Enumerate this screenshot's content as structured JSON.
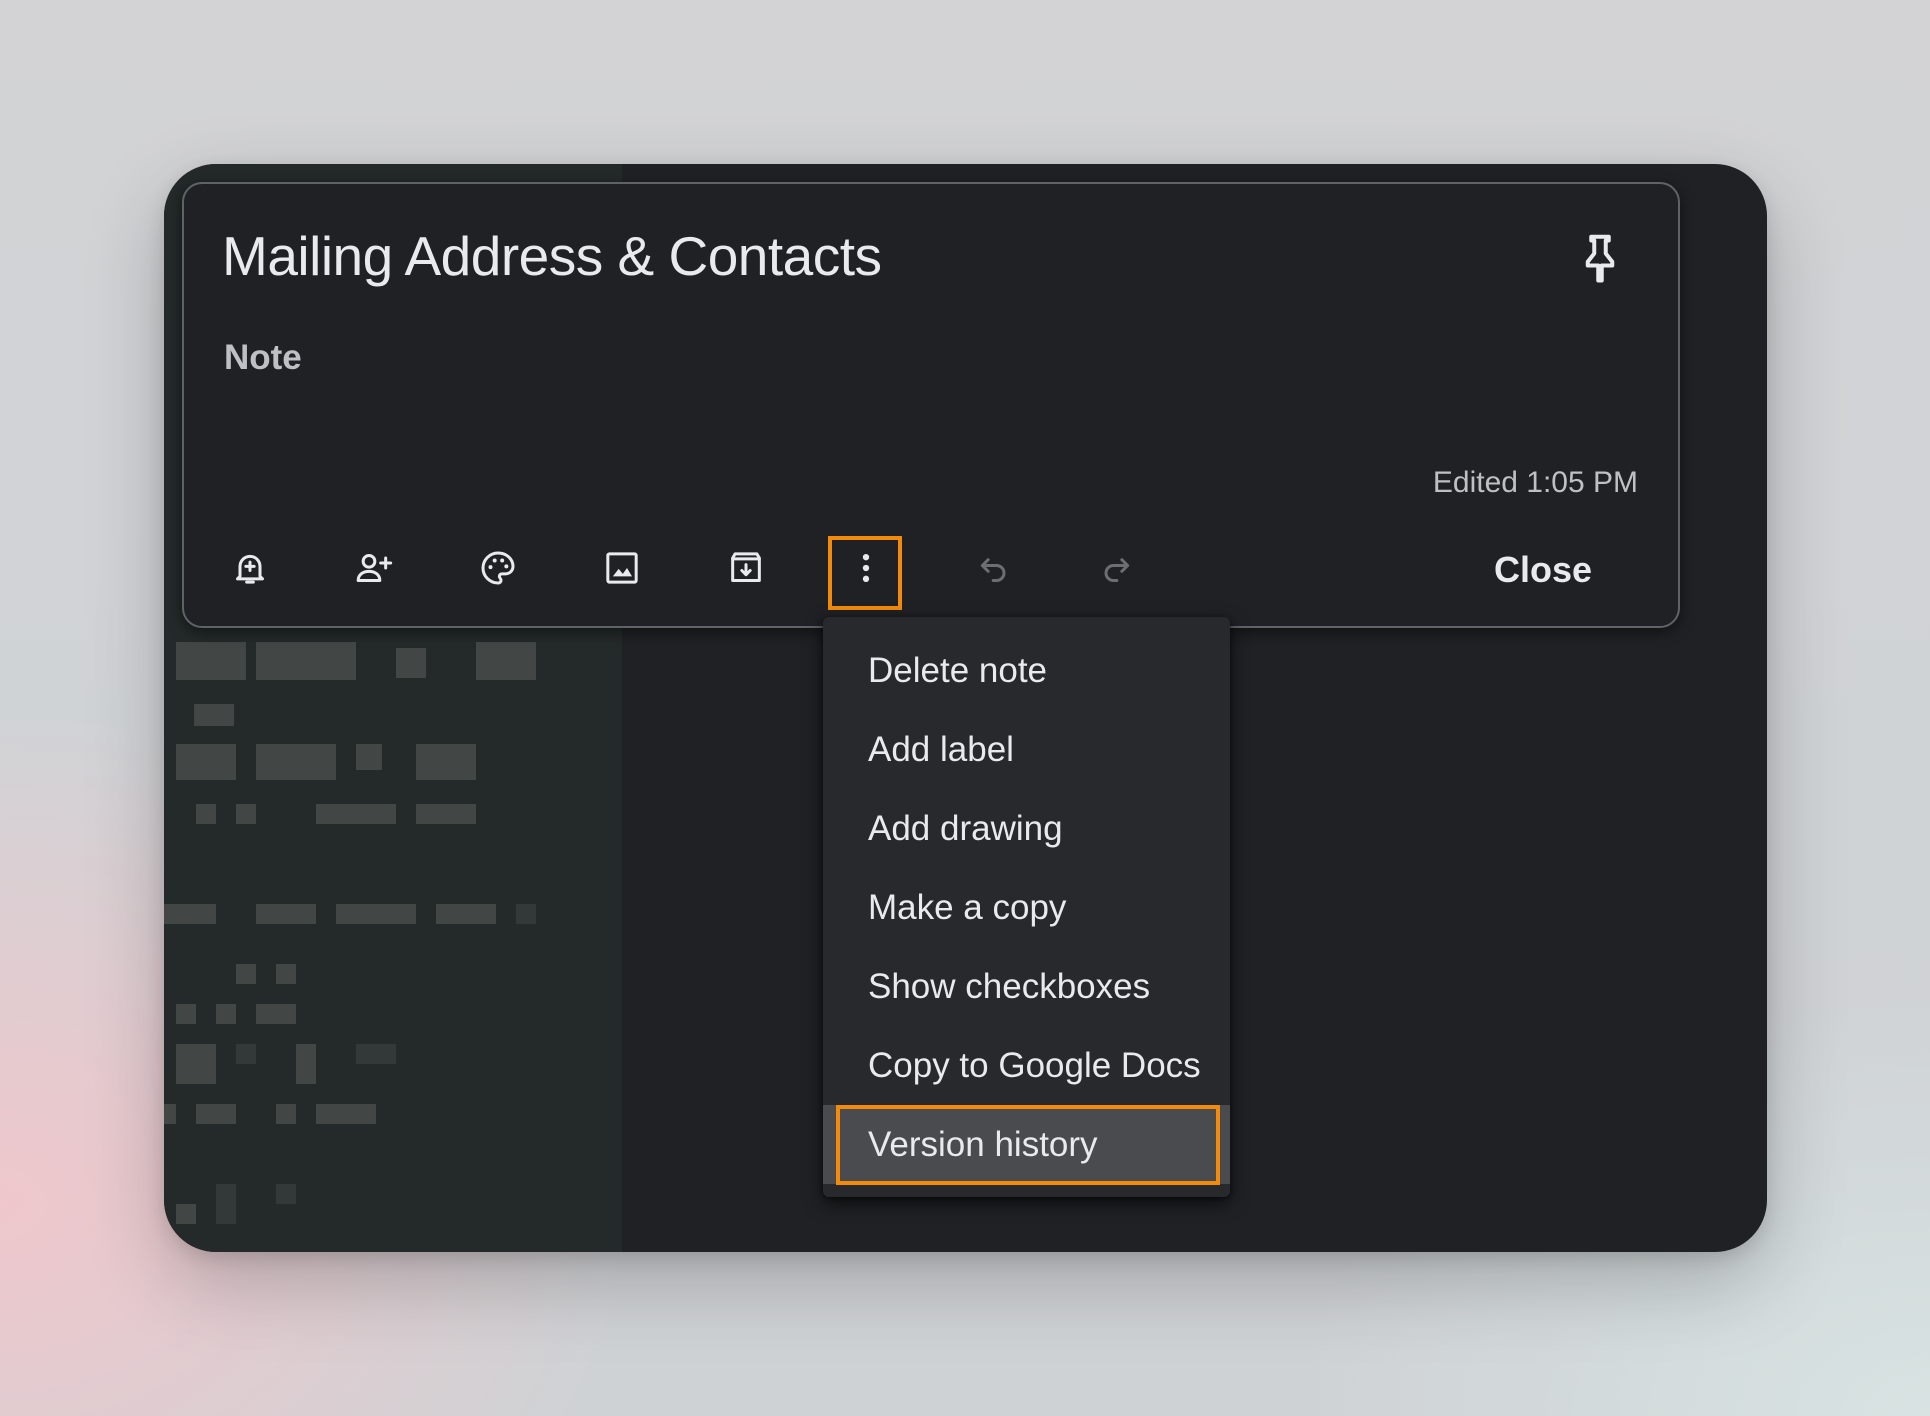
{
  "note": {
    "title": "Mailing Address & Contacts",
    "body_placeholder": "Note",
    "edited": "Edited 1:05 PM"
  },
  "toolbar": {
    "buttons": [
      {
        "icon": "remind-me-icon"
      },
      {
        "icon": "collaborator-icon"
      },
      {
        "icon": "palette-icon"
      },
      {
        "icon": "image-icon"
      },
      {
        "icon": "archive-icon"
      },
      {
        "icon": "more-vert-icon"
      },
      {
        "icon": "undo-icon"
      },
      {
        "icon": "redo-icon"
      }
    ],
    "close_label": "Close"
  },
  "menu": {
    "items": [
      {
        "label": "Delete note"
      },
      {
        "label": "Add label"
      },
      {
        "label": "Add drawing"
      },
      {
        "label": "Make a copy"
      },
      {
        "label": "Show checkboxes"
      },
      {
        "label": "Copy to Google Docs"
      },
      {
        "label": "Version history"
      }
    ]
  },
  "colors": {
    "highlight": "#f28b0c",
    "surface": "#202124",
    "menu": "#28292c",
    "text": "#e8eaed"
  }
}
